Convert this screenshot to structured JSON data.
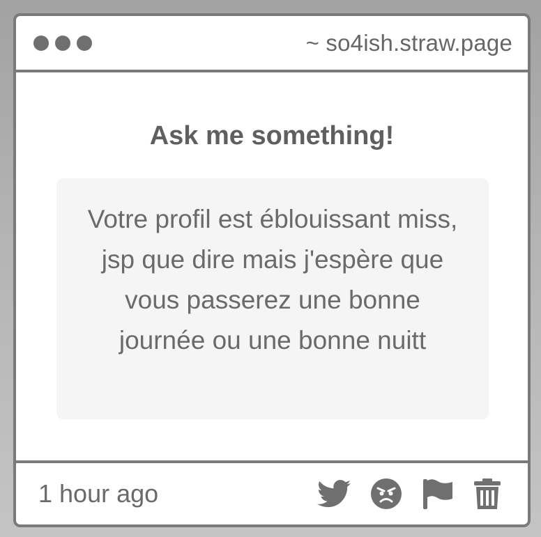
{
  "window": {
    "url": "~ so4ish.straw.page"
  },
  "main": {
    "title": "Ask me something!",
    "question": "Votre profil est éblouissant miss, jsp que dire mais j'espère que vous passerez une bonne journée ou une bonne nuitt"
  },
  "footer": {
    "timestamp": "1 hour ago",
    "actions": [
      {
        "icon": "twitter-icon"
      },
      {
        "icon": "angry-face-icon"
      },
      {
        "icon": "flag-icon"
      },
      {
        "icon": "trash-icon"
      }
    ]
  },
  "colors": {
    "border": "#7a7a7a",
    "text": "#6a6a6a",
    "box_background": "#f5f5f5",
    "icon": "#6f6f6f"
  }
}
